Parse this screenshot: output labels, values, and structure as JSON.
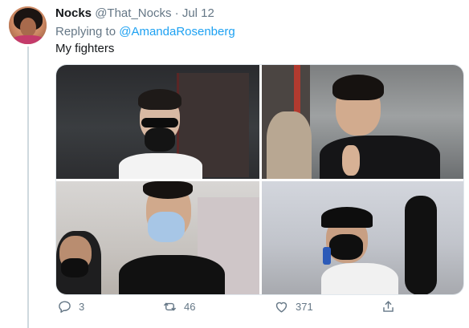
{
  "tweet": {
    "author_name": "Nocks",
    "author_handle": "@That_Nocks",
    "separator": "·",
    "date": "Jul 12",
    "replying_to_label": "Replying to",
    "replying_to_handle": "@AmandaRosenberg",
    "text": "My fighters"
  },
  "media": {
    "photo_count": 4
  },
  "actions": {
    "reply_icon": "reply-icon",
    "reply_count": "3",
    "retweet_icon": "retweet-icon",
    "retweet_count": "46",
    "like_icon": "heart-icon",
    "like_count": "371",
    "share_icon": "share-icon"
  },
  "colors": {
    "mention_blue": "#1da1f2",
    "muted_gray": "#657786",
    "text_dark": "#14171a",
    "thread_line": "#cfd9de"
  }
}
